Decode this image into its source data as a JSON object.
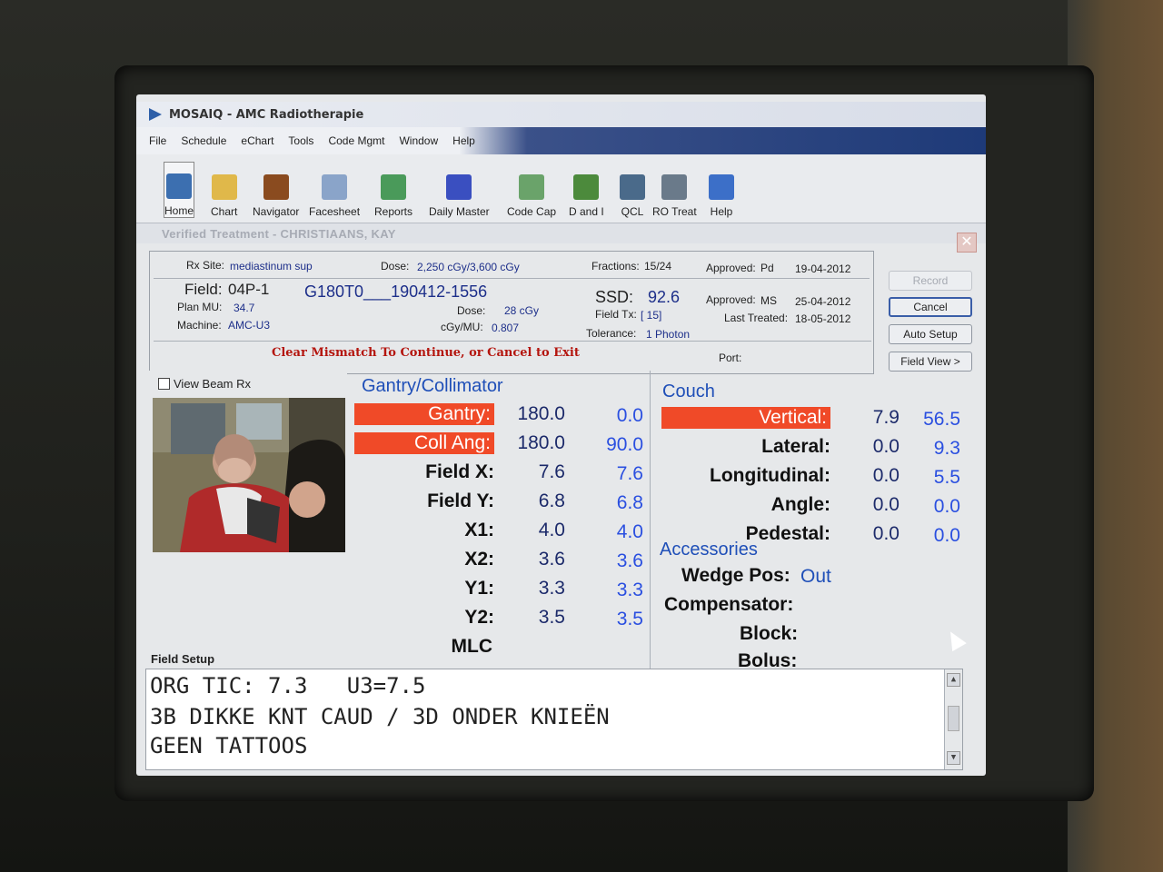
{
  "window": {
    "title": "MOSAIQ - AMC Radiotherapie"
  },
  "menu": [
    "File",
    "Schedule",
    "eChart",
    "Tools",
    "Code Mgmt",
    "Window",
    "Help"
  ],
  "toolbar": [
    {
      "label": "Home",
      "icon": "home-icon",
      "color": "#3c6fb0"
    },
    {
      "label": "Chart",
      "icon": "folder-icon",
      "color": "#e0b84a"
    },
    {
      "label": "Navigator",
      "icon": "compass-icon",
      "color": "#8a4b1f"
    },
    {
      "label": "Facesheet",
      "icon": "document-icon",
      "color": "#8aa4c9"
    },
    {
      "label": "Reports",
      "icon": "report-icon",
      "color": "#4a9a5a"
    },
    {
      "label": "Daily Master",
      "icon": "calendar-icon",
      "color": "#3a4fc0"
    },
    {
      "label": "Code Cap",
      "icon": "pin-icon",
      "color": "#6aa36a"
    },
    {
      "label": "D and I",
      "icon": "list-icon",
      "color": "#4c8a3c"
    },
    {
      "label": "QCL",
      "icon": "checklist-icon",
      "color": "#4a6a8a"
    },
    {
      "label": "RO Treat",
      "icon": "treatment-icon",
      "color": "#6a7a8a"
    },
    {
      "label": "Help",
      "icon": "help-icon",
      "color": "#3c6fc8"
    }
  ],
  "subwindow": {
    "title": "Verified Treatment - CHRISTIAANS, KAY"
  },
  "info": {
    "rx_site_label": "Rx Site:",
    "rx_site": "mediastinum sup",
    "dose_label": "Dose:",
    "dose": "2,250 cGy/3,600 cGy",
    "fractions_label": "Fractions:",
    "fractions": "15/24",
    "approved1_label": "Approved:",
    "approved1_by": "Pd",
    "approved1_date": "19-04-2012",
    "field_label": "Field:",
    "field": "04P-1",
    "field_id": "G180T0___190412-1556",
    "plan_mu_label": "Plan MU:",
    "plan_mu": "34.7",
    "machine_label": "Machine:",
    "machine": "AMC-U3",
    "field_dose_label": "Dose:",
    "field_dose": "28 cGy",
    "cgy_mu_label": "cGy/MU:",
    "cgy_mu": "0.807",
    "ssd_label": "SSD:",
    "ssd": "92.6",
    "field_tx_label": "Field Tx:",
    "field_tx": "[ 15]",
    "tolerance_label": "Tolerance:",
    "tolerance": "1  Photon",
    "approved2_label": "Approved:",
    "approved2_by": "MS",
    "approved2_date": "25-04-2012",
    "last_treated_label": "Last Treated:",
    "last_treated": "18-05-2012",
    "mismatch": "Clear Mismatch To Continue, or Cancel to Exit",
    "port_label": "Port:"
  },
  "buttons": {
    "record": "Record",
    "cancel": "Cancel",
    "auto_setup": "Auto Setup",
    "field_view": "Field View >"
  },
  "left": {
    "view_beam_rx": "View Beam Rx",
    "field_setup": "Field Setup"
  },
  "gantry": {
    "title": "Gantry/Collimator",
    "rows": [
      {
        "label": "Gantry:",
        "v1": "180.0",
        "v2": "0.0",
        "mismatch": true
      },
      {
        "label": "Coll Ang:",
        "v1": "180.0",
        "v2": "90.0",
        "mismatch": true
      },
      {
        "label": "Field X:",
        "v1": "7.6",
        "v2": "7.6",
        "mismatch": false
      },
      {
        "label": "Field Y:",
        "v1": "6.8",
        "v2": "6.8",
        "mismatch": false
      },
      {
        "label": "X1:",
        "v1": "4.0",
        "v2": "4.0",
        "mismatch": false
      },
      {
        "label": "X2:",
        "v1": "3.6",
        "v2": "3.6",
        "mismatch": false
      },
      {
        "label": "Y1:",
        "v1": "3.3",
        "v2": "3.3",
        "mismatch": false
      },
      {
        "label": "Y2:",
        "v1": "3.5",
        "v2": "3.5",
        "mismatch": false
      },
      {
        "label": "MLC",
        "v1": "",
        "v2": "",
        "mismatch": false
      }
    ]
  },
  "couch": {
    "title": "Couch",
    "rows": [
      {
        "label": "Vertical:",
        "v1": "7.9",
        "v2": "56.5",
        "mismatch": true
      },
      {
        "label": "Lateral:",
        "v1": "0.0",
        "v2": "9.3",
        "mismatch": false
      },
      {
        "label": "Longitudinal:",
        "v1": "0.0",
        "v2": "5.5",
        "mismatch": false
      },
      {
        "label": "Angle:",
        "v1": "0.0",
        "v2": "0.0",
        "mismatch": false
      },
      {
        "label": "Pedestal:",
        "v1": "0.0",
        "v2": "0.0",
        "mismatch": false
      }
    ]
  },
  "accessories": {
    "title": "Accessories",
    "wedge_label": "Wedge Pos:",
    "wedge": "Out",
    "compensator_label": "Compensator:",
    "block_label": "Block:",
    "bolus_label": "Bolus:"
  },
  "notes": [
    "ORG TIC: 7.3   U3=7.5",
    "3B DIKKE KNT CAUD / 3D ONDER KNIEËN",
    "GEEN TATTOOS"
  ],
  "colors": {
    "mismatch": "#f04a28",
    "accent": "#1f4fb8"
  }
}
